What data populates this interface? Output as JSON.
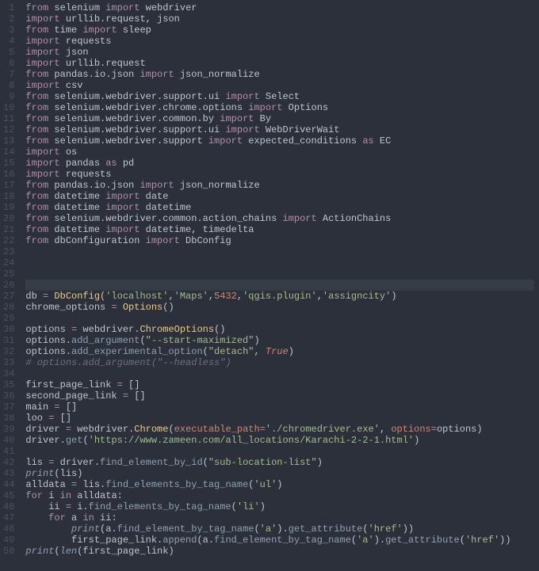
{
  "lines": [
    {
      "n": "1",
      "tokens": [
        {
          "c": "kw",
          "t": "from"
        },
        {
          "t": " selenium "
        },
        {
          "c": "kw",
          "t": "import"
        },
        {
          "t": " webdriver"
        }
      ]
    },
    {
      "n": "2",
      "tokens": [
        {
          "c": "kw",
          "t": "import"
        },
        {
          "t": " urllib.request, json"
        }
      ]
    },
    {
      "n": "3",
      "tokens": [
        {
          "c": "kw",
          "t": "from"
        },
        {
          "t": " time "
        },
        {
          "c": "kw",
          "t": "import"
        },
        {
          "t": " sleep"
        }
      ]
    },
    {
      "n": "4",
      "tokens": [
        {
          "c": "kw",
          "t": "import"
        },
        {
          "t": " requests"
        }
      ]
    },
    {
      "n": "5",
      "tokens": [
        {
          "c": "kw",
          "t": "import"
        },
        {
          "t": " json"
        }
      ]
    },
    {
      "n": "6",
      "tokens": [
        {
          "c": "kw",
          "t": "import"
        },
        {
          "t": " urllib.request"
        }
      ]
    },
    {
      "n": "7",
      "tokens": [
        {
          "c": "kw",
          "t": "from"
        },
        {
          "t": " pandas.io.json "
        },
        {
          "c": "kw",
          "t": "import"
        },
        {
          "t": " json_normalize"
        }
      ]
    },
    {
      "n": "8",
      "tokens": [
        {
          "c": "kw",
          "t": "import"
        },
        {
          "t": " csv"
        }
      ]
    },
    {
      "n": "9",
      "tokens": [
        {
          "c": "kw",
          "t": "from"
        },
        {
          "t": " selenium.webdriver.support.ui "
        },
        {
          "c": "kw",
          "t": "import"
        },
        {
          "t": " Select"
        }
      ]
    },
    {
      "n": "10",
      "tokens": [
        {
          "c": "kw",
          "t": "from"
        },
        {
          "t": " selenium.webdriver.chrome.options "
        },
        {
          "c": "kw",
          "t": "import"
        },
        {
          "t": " Options"
        }
      ]
    },
    {
      "n": "11",
      "tokens": [
        {
          "c": "kw",
          "t": "from"
        },
        {
          "t": " selenium.webdriver.common.by "
        },
        {
          "c": "kw",
          "t": "import"
        },
        {
          "t": " By"
        }
      ]
    },
    {
      "n": "12",
      "tokens": [
        {
          "c": "kw",
          "t": "from"
        },
        {
          "t": " selenium.webdriver.support.ui "
        },
        {
          "c": "kw",
          "t": "import"
        },
        {
          "t": " WebDriverWait"
        }
      ]
    },
    {
      "n": "13",
      "tokens": [
        {
          "c": "kw",
          "t": "from"
        },
        {
          "t": " selenium.webdriver.support "
        },
        {
          "c": "kw",
          "t": "import"
        },
        {
          "t": " expected_conditions "
        },
        {
          "c": "kw",
          "t": "as"
        },
        {
          "t": " EC"
        }
      ]
    },
    {
      "n": "14",
      "tokens": [
        {
          "c": "kw",
          "t": "import"
        },
        {
          "t": " os"
        }
      ]
    },
    {
      "n": "15",
      "tokens": [
        {
          "c": "kw",
          "t": "import"
        },
        {
          "t": " pandas "
        },
        {
          "c": "kw",
          "t": "as"
        },
        {
          "t": " pd"
        }
      ]
    },
    {
      "n": "16",
      "tokens": [
        {
          "c": "kw",
          "t": "import"
        },
        {
          "t": " requests"
        }
      ]
    },
    {
      "n": "17",
      "tokens": [
        {
          "c": "kw",
          "t": "from"
        },
        {
          "t": " pandas.io.json "
        },
        {
          "c": "kw",
          "t": "import"
        },
        {
          "t": " json_normalize"
        }
      ]
    },
    {
      "n": "18",
      "tokens": [
        {
          "c": "kw",
          "t": "from"
        },
        {
          "t": " datetime "
        },
        {
          "c": "kw",
          "t": "import"
        },
        {
          "t": " date"
        }
      ]
    },
    {
      "n": "19",
      "tokens": [
        {
          "c": "kw",
          "t": "from"
        },
        {
          "t": " datetime "
        },
        {
          "c": "kw",
          "t": "import"
        },
        {
          "t": " datetime"
        }
      ]
    },
    {
      "n": "20",
      "tokens": [
        {
          "c": "kw",
          "t": "from"
        },
        {
          "t": " selenium.webdriver.common.action_chains "
        },
        {
          "c": "kw",
          "t": "import"
        },
        {
          "t": " ActionChains"
        }
      ]
    },
    {
      "n": "21",
      "tokens": [
        {
          "c": "kw",
          "t": "from"
        },
        {
          "t": " datetime "
        },
        {
          "c": "kw",
          "t": "import"
        },
        {
          "t": " datetime, timedelta"
        }
      ]
    },
    {
      "n": "22",
      "tokens": [
        {
          "c": "kw",
          "t": "from"
        },
        {
          "t": " dbConfiguration "
        },
        {
          "c": "kw",
          "t": "import"
        },
        {
          "t": " DbConfig"
        }
      ]
    },
    {
      "n": "23",
      "tokens": []
    },
    {
      "n": "24",
      "tokens": []
    },
    {
      "n": "25",
      "tokens": []
    },
    {
      "n": "26",
      "tokens": [],
      "cursor": true
    },
    {
      "n": "27",
      "tokens": [
        {
          "t": "db "
        },
        {
          "c": "kw",
          "t": "="
        },
        {
          "t": " "
        },
        {
          "c": "cls",
          "t": "DbConfig"
        },
        {
          "t": "("
        },
        {
          "c": "str",
          "t": "'localhost'"
        },
        {
          "t": ","
        },
        {
          "c": "str",
          "t": "'Maps'"
        },
        {
          "t": ","
        },
        {
          "c": "num",
          "t": "5432"
        },
        {
          "t": ","
        },
        {
          "c": "str",
          "t": "'qgis.plugin'"
        },
        {
          "t": ","
        },
        {
          "c": "str",
          "t": "'assigncity'"
        },
        {
          "t": ")"
        }
      ]
    },
    {
      "n": "28",
      "tokens": [
        {
          "t": "chrome_options "
        },
        {
          "c": "kw",
          "t": "="
        },
        {
          "t": " "
        },
        {
          "c": "cls",
          "t": "Options"
        },
        {
          "t": "()"
        }
      ]
    },
    {
      "n": "29",
      "tokens": []
    },
    {
      "n": "30",
      "tokens": [
        {
          "t": "options "
        },
        {
          "c": "kw",
          "t": "="
        },
        {
          "t": " webdriver."
        },
        {
          "c": "cls",
          "t": "ChromeOptions"
        },
        {
          "t": "()"
        }
      ]
    },
    {
      "n": "31",
      "tokens": [
        {
          "t": "options."
        },
        {
          "c": "fn",
          "t": "add_argument"
        },
        {
          "t": "("
        },
        {
          "c": "str",
          "t": "\"--start-maximized\""
        },
        {
          "t": ")"
        }
      ]
    },
    {
      "n": "32",
      "tokens": [
        {
          "t": "options."
        },
        {
          "c": "fn",
          "t": "add_experimental_option"
        },
        {
          "t": "("
        },
        {
          "c": "str",
          "t": "\"detach\""
        },
        {
          "t": ", "
        },
        {
          "c": "bool",
          "i": true,
          "t": "True"
        },
        {
          "t": ")"
        }
      ]
    },
    {
      "n": "33",
      "tokens": [
        {
          "c": "comment",
          "t": "# options.add_argument(\"--headless\")"
        }
      ]
    },
    {
      "n": "34",
      "tokens": []
    },
    {
      "n": "35",
      "tokens": [
        {
          "t": "first_page_link "
        },
        {
          "c": "kw",
          "t": "="
        },
        {
          "t": " []"
        }
      ]
    },
    {
      "n": "36",
      "tokens": [
        {
          "t": "second_page_link "
        },
        {
          "c": "kw",
          "t": "="
        },
        {
          "t": " []"
        }
      ]
    },
    {
      "n": "37",
      "tokens": [
        {
          "t": "main "
        },
        {
          "c": "kw",
          "t": "="
        },
        {
          "t": " []"
        }
      ]
    },
    {
      "n": "38",
      "tokens": [
        {
          "t": "loo "
        },
        {
          "c": "kw",
          "t": "="
        },
        {
          "t": " []"
        }
      ]
    },
    {
      "n": "39",
      "tokens": [
        {
          "t": "driver "
        },
        {
          "c": "kw",
          "t": "="
        },
        {
          "t": " webdriver."
        },
        {
          "c": "cls",
          "t": "Chrome"
        },
        {
          "t": "("
        },
        {
          "c": "param",
          "t": "executable_path"
        },
        {
          "c": "kw",
          "t": "="
        },
        {
          "c": "str",
          "t": "'./chromedriver.exe'"
        },
        {
          "t": ", "
        },
        {
          "c": "param",
          "t": "options"
        },
        {
          "c": "kw",
          "t": "="
        },
        {
          "t": "options)"
        }
      ]
    },
    {
      "n": "40",
      "tokens": [
        {
          "t": "driver."
        },
        {
          "c": "fn",
          "t": "get"
        },
        {
          "t": "("
        },
        {
          "c": "str",
          "t": "'https://www.zameen.com/all_locations/Karachi-2-2-1.html'"
        },
        {
          "t": ")"
        }
      ]
    },
    {
      "n": "41",
      "tokens": []
    },
    {
      "n": "42",
      "tokens": [
        {
          "t": "lis "
        },
        {
          "c": "kw",
          "t": "="
        },
        {
          "t": " driver."
        },
        {
          "c": "fn",
          "t": "find_element_by_id"
        },
        {
          "t": "("
        },
        {
          "c": "str",
          "t": "\"sub-location-list\""
        },
        {
          "t": ")"
        }
      ]
    },
    {
      "n": "43",
      "tokens": [
        {
          "c": "builtin",
          "t": "print"
        },
        {
          "t": "(lis)"
        }
      ]
    },
    {
      "n": "44",
      "tokens": [
        {
          "t": "alldata "
        },
        {
          "c": "kw",
          "t": "="
        },
        {
          "t": " lis."
        },
        {
          "c": "fn",
          "t": "find_elements_by_tag_name"
        },
        {
          "t": "("
        },
        {
          "c": "str",
          "t": "'ul'"
        },
        {
          "t": ")"
        }
      ]
    },
    {
      "n": "45",
      "tokens": [
        {
          "c": "kw",
          "t": "for"
        },
        {
          "t": " i "
        },
        {
          "c": "kw",
          "t": "in"
        },
        {
          "t": " alldata:"
        }
      ]
    },
    {
      "n": "46",
      "tokens": [
        {
          "t": "    ii "
        },
        {
          "c": "kw",
          "t": "="
        },
        {
          "t": " i."
        },
        {
          "c": "fn",
          "t": "find_elements_by_tag_name"
        },
        {
          "t": "("
        },
        {
          "c": "str",
          "t": "'li'"
        },
        {
          "t": ")"
        }
      ]
    },
    {
      "n": "47",
      "tokens": [
        {
          "t": "    "
        },
        {
          "c": "kw",
          "t": "for"
        },
        {
          "t": " a "
        },
        {
          "c": "kw",
          "t": "in"
        },
        {
          "t": " ii:"
        }
      ]
    },
    {
      "n": "48",
      "tokens": [
        {
          "t": "        "
        },
        {
          "c": "builtin",
          "t": "print"
        },
        {
          "t": "(a."
        },
        {
          "c": "fn",
          "t": "find_element_by_tag_name"
        },
        {
          "t": "("
        },
        {
          "c": "str",
          "t": "'a'"
        },
        {
          "t": ")."
        },
        {
          "c": "fn",
          "t": "get_attribute"
        },
        {
          "t": "("
        },
        {
          "c": "str",
          "t": "'href'"
        },
        {
          "t": "))"
        }
      ]
    },
    {
      "n": "49",
      "tokens": [
        {
          "t": "        first_page_link."
        },
        {
          "c": "fn",
          "t": "append"
        },
        {
          "t": "(a."
        },
        {
          "c": "fn",
          "t": "find_element_by_tag_name"
        },
        {
          "t": "("
        },
        {
          "c": "str",
          "t": "'a'"
        },
        {
          "t": ")."
        },
        {
          "c": "fn",
          "t": "get_attribute"
        },
        {
          "t": "("
        },
        {
          "c": "str",
          "t": "'href'"
        },
        {
          "t": "))"
        }
      ]
    },
    {
      "n": "50",
      "tokens": [
        {
          "c": "builtin",
          "t": "print"
        },
        {
          "t": "("
        },
        {
          "c": "builtin",
          "t": "len"
        },
        {
          "t": "(first_page_link)"
        }
      ]
    }
  ]
}
